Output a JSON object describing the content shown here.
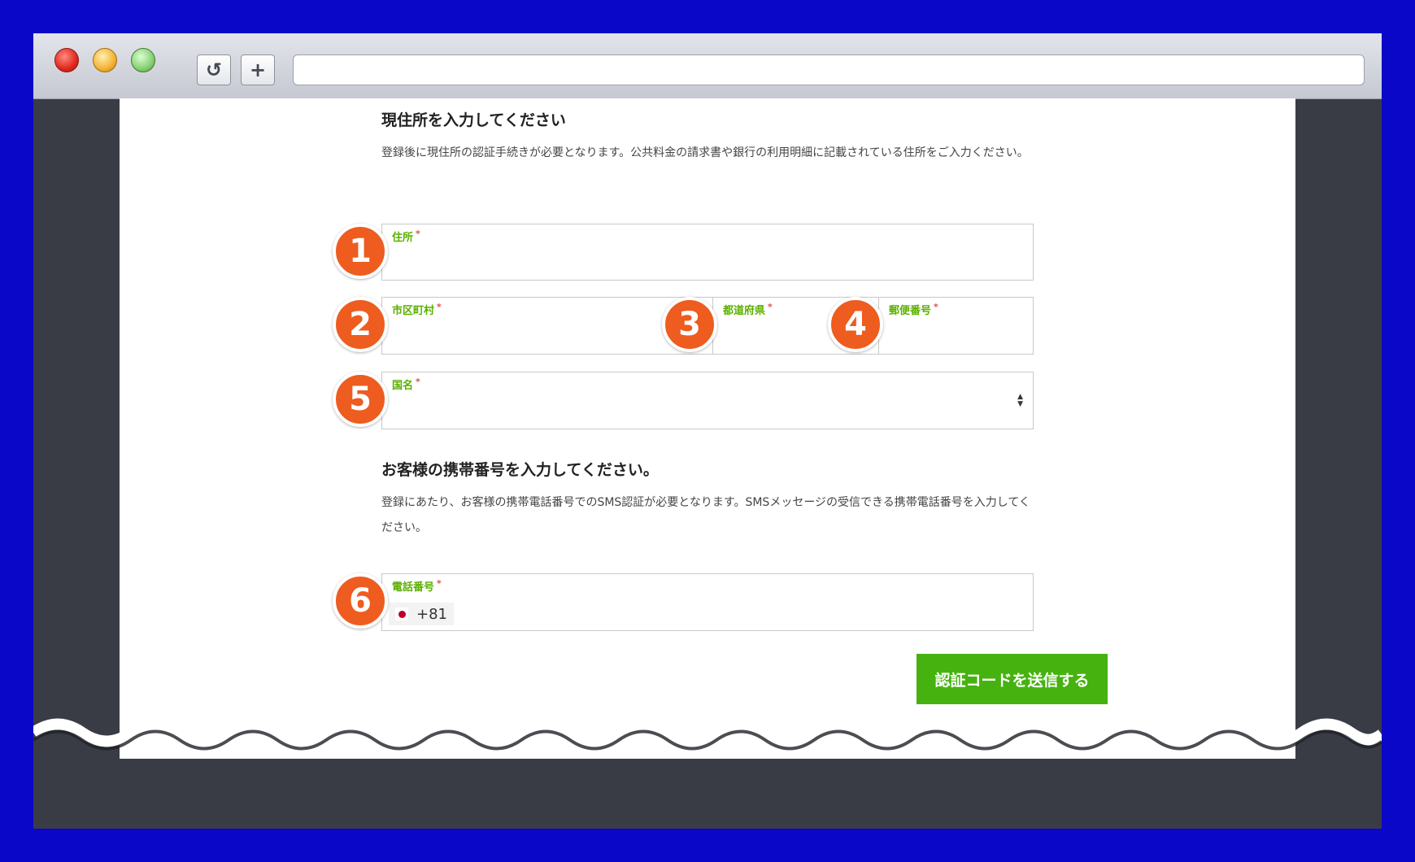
{
  "browser": {
    "reload_icon": "↺",
    "new_tab_icon": "+",
    "address": ""
  },
  "address_section": {
    "title": "現住所を入力してください",
    "description": "登録後に現住所の認証手続きが必要となります。公共料金の請求書や銀行の利用明細に記載されている住所をご入力ください。"
  },
  "fields": {
    "address": {
      "label": "住所",
      "value": ""
    },
    "city": {
      "label": "市区町村",
      "value": ""
    },
    "prefecture": {
      "label": "都道府県",
      "value": ""
    },
    "postal_code": {
      "label": "郵便番号",
      "value": ""
    },
    "country": {
      "label": "国名",
      "value": ""
    },
    "phone": {
      "label": "電話番号",
      "country_code": "+81",
      "value": ""
    }
  },
  "required_mark": "*",
  "phone_section": {
    "title": "お客様の携帯番号を入力してください。",
    "description": "登録にあたり、お客様の携帯電話番号でのSMS認証が必要となります。SMSメッセージの受信できる携帯電話番号を入力してください。"
  },
  "submit_label": "認証コードを送信する",
  "badges": [
    "1",
    "2",
    "3",
    "4",
    "5",
    "6"
  ],
  "colors": {
    "badge": "#ee5c1f",
    "label_green": "#5bb000",
    "button_green": "#46b20f",
    "frame_blue": "#0a07c9"
  }
}
